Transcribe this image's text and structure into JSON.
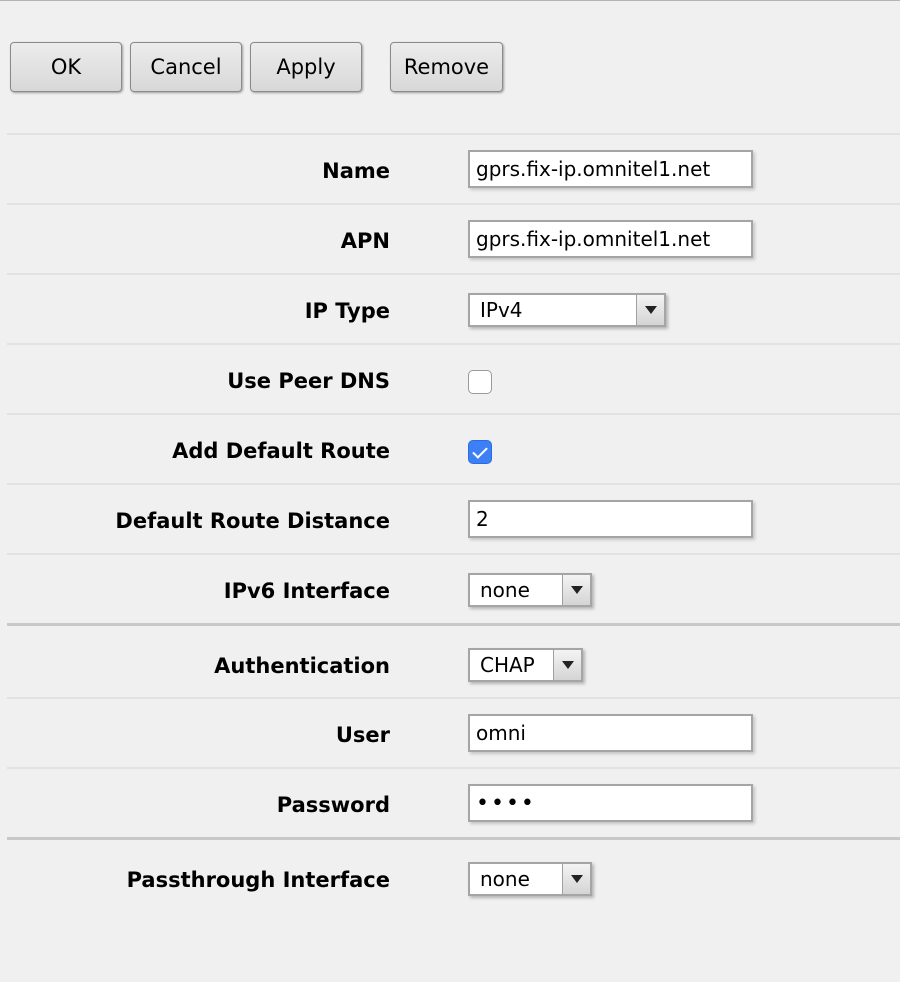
{
  "toolbar": {
    "ok_label": "OK",
    "cancel_label": "Cancel",
    "apply_label": "Apply",
    "remove_label": "Remove"
  },
  "form": {
    "name": {
      "label": "Name",
      "value": "gprs.fix-ip.omnitel1.net"
    },
    "apn": {
      "label": "APN",
      "value": "gprs.fix-ip.omnitel1.net"
    },
    "ip_type": {
      "label": "IP Type",
      "value": "IPv4"
    },
    "use_peer_dns": {
      "label": "Use Peer DNS",
      "checked": false
    },
    "add_default_route": {
      "label": "Add Default Route",
      "checked": true
    },
    "default_route_distance": {
      "label": "Default Route Distance",
      "value": "2"
    },
    "ipv6_interface": {
      "label": "IPv6 Interface",
      "value": "none"
    },
    "authentication": {
      "label": "Authentication",
      "value": "CHAP"
    },
    "user": {
      "label": "User",
      "value": "omni"
    },
    "password": {
      "label": "Password",
      "value": "••••"
    },
    "passthrough_interface": {
      "label": "Passthrough Interface",
      "value": "none"
    }
  },
  "colors": {
    "background": "#f0f0f0",
    "checkbox_checked": "#3d7ff5"
  },
  "icons": {
    "dropdown": "chevron-down-icon",
    "checkmark": "checkmark-icon"
  }
}
